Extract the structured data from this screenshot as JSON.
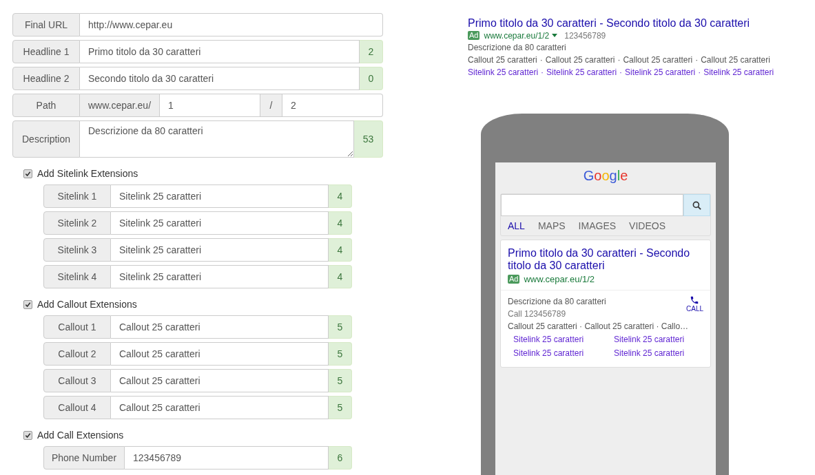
{
  "form": {
    "rows": [
      {
        "kind": "input",
        "label": "Final URL",
        "value": "http://www.cepar.eu"
      },
      {
        "kind": "input",
        "label": "Headline 1",
        "value": "Primo titolo da 30 caratteri",
        "count": "2"
      },
      {
        "kind": "input",
        "label": "Headline 2",
        "value": "Secondo titolo da 30 caratteri",
        "count": "0"
      },
      {
        "kind": "path",
        "label": "Path",
        "prefix": "www.cepar.eu/",
        "value": "1",
        "separator": "/",
        "value2": "2"
      },
      {
        "kind": "textarea",
        "label": "Description",
        "value": "Descrizione da 80 caratteri",
        "count": "53"
      }
    ]
  },
  "extensions": [
    {
      "label": "Add Sitelink Extensions",
      "checked": true,
      "rows": [
        {
          "label": "Sitelink 1",
          "value": "Sitelink 25 caratteri",
          "count": "4"
        },
        {
          "label": "Sitelink 2",
          "value": "Sitelink 25 caratteri",
          "count": "4"
        },
        {
          "label": "Sitelink 3",
          "value": "Sitelink 25 caratteri",
          "count": "4"
        },
        {
          "label": "Sitelink 4",
          "value": "Sitelink 25 caratteri",
          "count": "4"
        }
      ]
    },
    {
      "label": "Add Callout Extensions",
      "checked": true,
      "rows": [
        {
          "label": "Callout 1",
          "value": "Callout 25 caratteri",
          "count": "5"
        },
        {
          "label": "Callout 2",
          "value": "Callout 25 caratteri",
          "count": "5"
        },
        {
          "label": "Callout 3",
          "value": "Callout 25 caratteri",
          "count": "5"
        },
        {
          "label": "Callout 4",
          "value": "Callout 25 caratteri",
          "count": "5"
        }
      ]
    },
    {
      "label": "Add Call Extensions",
      "checked": true,
      "rows": [
        {
          "label": "Phone Number",
          "value": "123456789",
          "count": "6"
        }
      ]
    }
  ],
  "desktop_preview": {
    "title": "Primo titolo da 30 caratteri - Secondo titolo da 30 caratteri",
    "ad_badge": "Ad",
    "display_url": "www.cepar.eu/1/2",
    "phone": "123456789",
    "description": "Descrizione da 80 caratteri",
    "separator": "·",
    "callouts": [
      "Callout 25 caratteri",
      "Callout 25 caratteri",
      "Callout 25 caratteri",
      "Callout 25 caratteri"
    ],
    "sitelinks": [
      "Sitelink 25 caratteri",
      "Sitelink 25 caratteri",
      "Sitelink 25 caratteri",
      "Sitelink 25 caratteri"
    ]
  },
  "mobile_preview": {
    "logo": "Google",
    "tabs": [
      {
        "label": "ALL",
        "selected": true
      },
      {
        "label": "MAPS",
        "selected": false
      },
      {
        "label": "IMAGES",
        "selected": false
      },
      {
        "label": "VIDEOS",
        "selected": false
      }
    ],
    "ad": {
      "title": "Primo titolo da 30 caratteri - Secondo titolo da 30 caratteri",
      "ad_badge": "Ad",
      "display_url": "www.cepar.eu/1/2",
      "description": "Descrizione da 80 caratteri",
      "call_text": "Call 123456789",
      "call_label": "CALL",
      "callouts": "Callout 25 caratteri · Callout 25 caratteri · Callo…",
      "sitelinks": [
        "Sitelink 25 caratteri",
        "Sitelink 25 caratteri",
        "Sitelink 25 caratteri",
        "Sitelink 25 caratteri"
      ]
    }
  }
}
